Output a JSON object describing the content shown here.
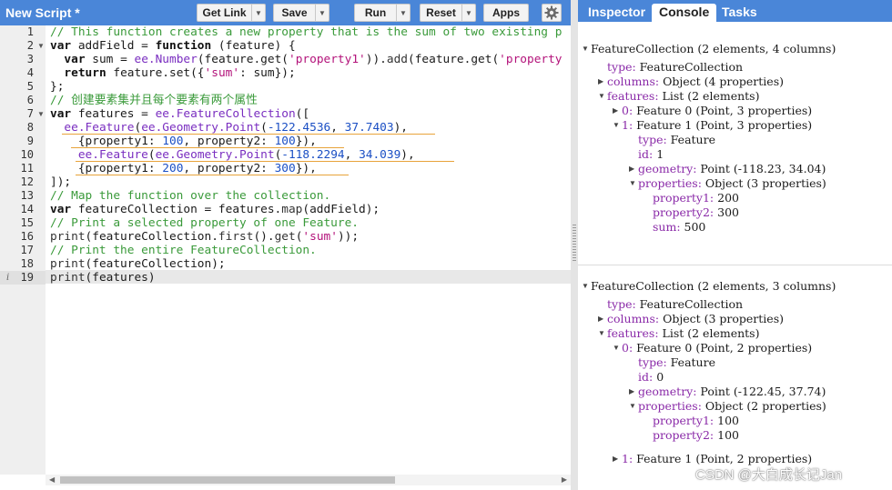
{
  "editor": {
    "title": "New Script *",
    "buttons": {
      "get_link": "Get Link",
      "save": "Save",
      "run": "Run",
      "reset": "Reset",
      "apps": "Apps"
    },
    "line_numbers": [
      "1",
      "2",
      "3",
      "4",
      "5",
      "6",
      "7",
      "8",
      "9",
      "10",
      "11",
      "12",
      "13",
      "14",
      "15",
      "16",
      "17",
      "18",
      "19"
    ],
    "code_lines": [
      [
        [
          "c-com",
          "// This function creates a new property that is the sum of two existing p"
        ]
      ],
      [
        [
          "c-kw",
          "var"
        ],
        [
          "",
          "addField = "
        ],
        [
          "c-kw",
          "function"
        ],
        [
          "",
          "(feature) {"
        ]
      ],
      [
        [
          "",
          "  "
        ],
        [
          "c-kw",
          "var"
        ],
        [
          "",
          "sum = "
        ],
        [
          "c-ee",
          "ee.Number"
        ],
        [
          "",
          "(feature.get("
        ],
        [
          "c-str",
          "'property1'"
        ],
        [
          "",
          "))."
        ],
        [
          "c-fn",
          "add"
        ],
        [
          "",
          "(feature.get("
        ],
        [
          "c-str",
          "'property"
        ]
      ],
      [
        [
          "",
          "  "
        ],
        [
          "c-kw",
          "return"
        ],
        [
          "",
          "feature.set({"
        ],
        [
          "c-str",
          "'sum'"
        ],
        [
          "",
          ": sum});"
        ]
      ],
      [
        [
          "",
          "};"
        ]
      ],
      [
        [
          "c-com",
          "// 创建要素集并且每个要素有两个属性"
        ]
      ],
      [
        [
          "c-kw",
          "var"
        ],
        [
          "",
          "features = "
        ],
        [
          "c-ee",
          "ee.FeatureCollection"
        ],
        [
          "",
          "(["
        ]
      ],
      [
        [
          "",
          "  "
        ],
        [
          "c-ee",
          "ee.Feature"
        ],
        [
          "",
          "("
        ],
        [
          "c-ee",
          "ee.Geometry.Point"
        ],
        [
          "",
          "("
        ],
        [
          "c-num",
          "-122.4536"
        ],
        [
          "",
          ", "
        ],
        [
          "c-num",
          "37.7403"
        ],
        [
          "",
          "),"
        ]
      ],
      [
        [
          "",
          "    {property1: "
        ],
        [
          "c-num",
          "100"
        ],
        [
          "",
          ", property2: "
        ],
        [
          "c-num",
          "100"
        ],
        [
          "",
          "}),"
        ]
      ],
      [
        [
          "",
          "    "
        ],
        [
          "c-ee",
          "ee.Feature"
        ],
        [
          "",
          "("
        ],
        [
          "c-ee",
          "ee.Geometry.Point"
        ],
        [
          "",
          "("
        ],
        [
          "c-num",
          "-118.2294"
        ],
        [
          "",
          ", "
        ],
        [
          "c-num",
          "34.039"
        ],
        [
          "",
          "),"
        ]
      ],
      [
        [
          "",
          "    {property1: "
        ],
        [
          "c-num",
          "200"
        ],
        [
          "",
          ", property2: "
        ],
        [
          "c-num",
          "300"
        ],
        [
          "",
          "}),"
        ]
      ],
      [
        [
          "",
          "]);"
        ]
      ],
      [
        [
          "c-com",
          "// Map the function over the collection."
        ]
      ],
      [
        [
          "c-kw",
          "var"
        ],
        [
          "",
          "featureCollection = features."
        ],
        [
          "c-fn",
          "map"
        ],
        [
          "",
          "(addField);"
        ]
      ],
      [
        [
          "c-com",
          "// Print a selected property of one Feature."
        ]
      ],
      [
        [
          "c-fn",
          "print"
        ],
        [
          "",
          "(featureCollection."
        ],
        [
          "c-fn",
          "first"
        ],
        [
          "",
          "()."
        ],
        [
          "c-fn",
          "get"
        ],
        [
          "",
          "("
        ],
        [
          "c-str",
          "'sum'"
        ],
        [
          "",
          "));"
        ]
      ],
      [
        [
          "c-com",
          "// Print the entire FeatureCollection."
        ]
      ],
      [
        [
          "c-fn",
          "print"
        ],
        [
          "",
          "(featureCollection);"
        ]
      ],
      [
        [
          "c-fn",
          "print"
        ],
        [
          "",
          "(features)"
        ]
      ]
    ]
  },
  "tabs": [
    "Inspector",
    "Console",
    "Tasks"
  ],
  "active_tab": "Console",
  "console_top": [
    "FeatureCollection (2 elements, 4 columns)",
    "type: FeatureCollection",
    "columns: Object (4 properties)",
    "features: List (2 elements)",
    "0: Feature 0 (Point, 3 properties)",
    "1: Feature 1 (Point, 3 properties)",
    "type: Feature",
    "id: 1",
    "geometry: Point (-118.23, 34.04)",
    "properties: Object (3 properties)",
    "property1: 200",
    "property2: 300",
    "sum: 500"
  ],
  "console_bottom": [
    "FeatureCollection (2 elements, 3 columns)",
    "type: FeatureCollection",
    "columns: Object (3 properties)",
    "features: List (2 elements)",
    "0: Feature 0 (Point, 2 properties)",
    "type: Feature",
    "id: 0",
    "geometry: Point (-122.45, 37.74)",
    "properties: Object (2 properties)",
    "property1: 100",
    "property2: 100",
    "1: Feature 1 (Point, 2 properties)"
  ],
  "watermark": "CSDN @大白成长记Jan",
  "colors": {
    "header_blue": "#4a86d8",
    "comment_green": "#3a9a3a",
    "ee_purple": "#7a2ec0",
    "string_magenta": "#b3127a",
    "number_blue": "#1b4fc4",
    "key_purple": "#8a2aa8"
  }
}
